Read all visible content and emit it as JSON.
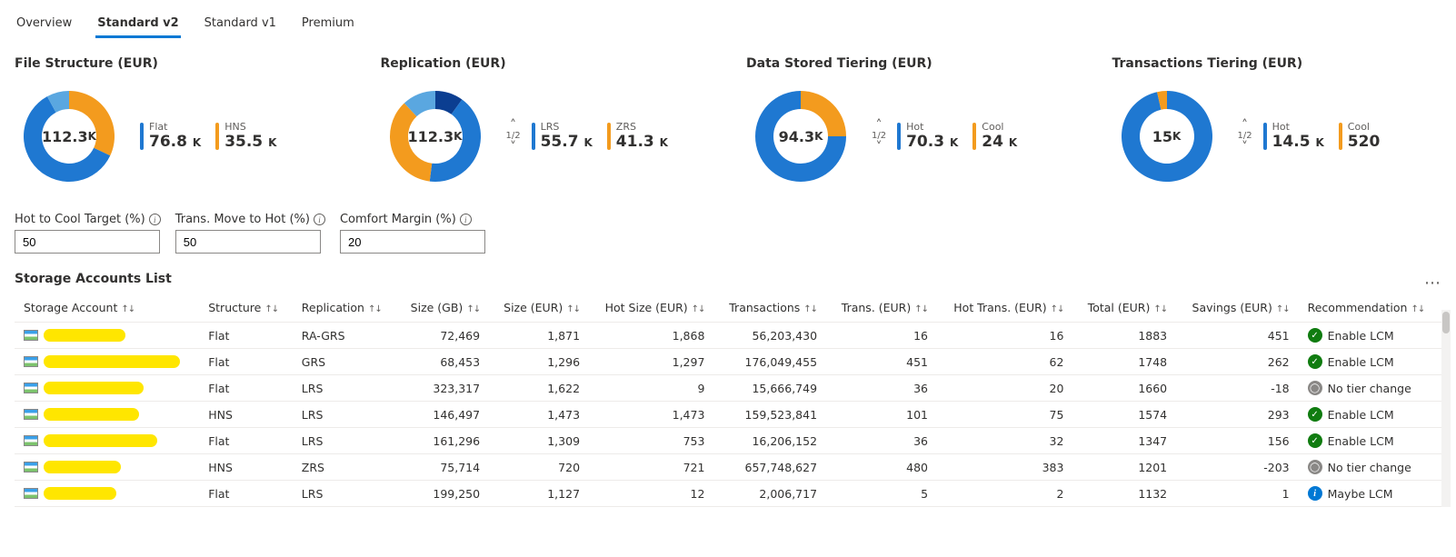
{
  "tabs": [
    "Overview",
    "Standard v2",
    "Standard v1",
    "Premium"
  ],
  "active_tab": 1,
  "charts": [
    {
      "title": "File Structure (EUR)",
      "center": "112.3",
      "center_unit": "K",
      "pager": null,
      "legend": [
        {
          "label": "Flat",
          "value": "76.8",
          "unit": "K",
          "color": "#1f78d1"
        },
        {
          "label": "HNS",
          "value": "35.5",
          "unit": "K",
          "color": "#f39b1e"
        }
      ],
      "slices": [
        {
          "color": "#f39b1e",
          "frac": 0.32
        },
        {
          "color": "#1f78d1",
          "frac": 0.6
        },
        {
          "color": "#5aa7e0",
          "frac": 0.08
        }
      ]
    },
    {
      "title": "Replication (EUR)",
      "center": "112.3",
      "center_unit": "K",
      "pager": "1/2",
      "legend": [
        {
          "label": "LRS",
          "value": "55.7",
          "unit": "K",
          "color": "#1f78d1"
        },
        {
          "label": "ZRS",
          "value": "41.3",
          "unit": "K",
          "color": "#f39b1e"
        }
      ],
      "slices": [
        {
          "color": "#0b3e91",
          "frac": 0.1
        },
        {
          "color": "#1f78d1",
          "frac": 0.42
        },
        {
          "color": "#f39b1e",
          "frac": 0.36
        },
        {
          "color": "#5aa7e0",
          "frac": 0.12
        }
      ]
    },
    {
      "title": "Data Stored Tiering (EUR)",
      "center": "94.3",
      "center_unit": "K",
      "pager": "1/2",
      "legend": [
        {
          "label": "Hot",
          "value": "70.3",
          "unit": "K",
          "color": "#1f78d1"
        },
        {
          "label": "Cool",
          "value": "24",
          "unit": "K",
          "color": "#f39b1e"
        }
      ],
      "slices": [
        {
          "color": "#f39b1e",
          "frac": 0.25
        },
        {
          "color": "#1f78d1",
          "frac": 0.75
        }
      ]
    },
    {
      "title": "Transactions Tiering (EUR)",
      "center": "15",
      "center_unit": "K",
      "pager": "1/2",
      "legend": [
        {
          "label": "Hot",
          "value": "14.5",
          "unit": "K",
          "color": "#1f78d1"
        },
        {
          "label": "Cool",
          "value": "520",
          "unit": "",
          "color": "#f39b1e"
        }
      ],
      "slices": [
        {
          "color": "#1f78d1",
          "frac": 0.965
        },
        {
          "color": "#f39b1e",
          "frac": 0.035
        }
      ]
    }
  ],
  "inputs": [
    {
      "label": "Hot to Cool Target (%)",
      "value": "50"
    },
    {
      "label": "Trans. Move to Hot (%)",
      "value": "50"
    },
    {
      "label": "Comfort Margin (%)",
      "value": "20"
    }
  ],
  "list_title": "Storage Accounts List",
  "columns": [
    {
      "label": "Storage Account",
      "num": false
    },
    {
      "label": "Structure",
      "num": false
    },
    {
      "label": "Replication",
      "num": false
    },
    {
      "label": "Size (GB)",
      "num": true
    },
    {
      "label": "Size (EUR)",
      "num": true
    },
    {
      "label": "Hot Size (EUR)",
      "num": true
    },
    {
      "label": "Transactions",
      "num": true
    },
    {
      "label": "Trans. (EUR)",
      "num": true
    },
    {
      "label": "Hot Trans. (EUR)",
      "num": true
    },
    {
      "label": "Total (EUR)",
      "num": true
    },
    {
      "label": "Savings (EUR)",
      "num": true
    },
    {
      "label": "Recommendation",
      "num": false
    }
  ],
  "rows": [
    {
      "rw": 90,
      "structure": "Flat",
      "replication": "RA-GRS",
      "size_gb": "72,469",
      "size_eur": "1,871",
      "hot_size": "1,868",
      "trans": "56,203,430",
      "trans_eur": "16",
      "hot_trans": "16",
      "total": "1883",
      "savings": "451",
      "rec": "Enable LCM",
      "rec_kind": "ok"
    },
    {
      "rw": 150,
      "structure": "Flat",
      "replication": "GRS",
      "size_gb": "68,453",
      "size_eur": "1,296",
      "hot_size": "1,297",
      "trans": "176,049,455",
      "trans_eur": "451",
      "hot_trans": "62",
      "total": "1748",
      "savings": "262",
      "rec": "Enable LCM",
      "rec_kind": "ok"
    },
    {
      "rw": 110,
      "structure": "Flat",
      "replication": "LRS",
      "size_gb": "323,317",
      "size_eur": "1,622",
      "hot_size": "9",
      "trans": "15,666,749",
      "trans_eur": "36",
      "hot_trans": "20",
      "total": "1660",
      "savings": "-18",
      "rec": "No tier change",
      "rec_kind": "none"
    },
    {
      "rw": 105,
      "structure": "HNS",
      "replication": "LRS",
      "size_gb": "146,497",
      "size_eur": "1,473",
      "hot_size": "1,473",
      "trans": "159,523,841",
      "trans_eur": "101",
      "hot_trans": "75",
      "total": "1574",
      "savings": "293",
      "rec": "Enable LCM",
      "rec_kind": "ok"
    },
    {
      "rw": 125,
      "structure": "Flat",
      "replication": "LRS",
      "size_gb": "161,296",
      "size_eur": "1,309",
      "hot_size": "753",
      "trans": "16,206,152",
      "trans_eur": "36",
      "hot_trans": "32",
      "total": "1347",
      "savings": "156",
      "rec": "Enable LCM",
      "rec_kind": "ok"
    },
    {
      "rw": 85,
      "structure": "HNS",
      "replication": "ZRS",
      "size_gb": "75,714",
      "size_eur": "720",
      "hot_size": "721",
      "trans": "657,748,627",
      "trans_eur": "480",
      "hot_trans": "383",
      "total": "1201",
      "savings": "-203",
      "rec": "No tier change",
      "rec_kind": "none"
    },
    {
      "rw": 80,
      "structure": "Flat",
      "replication": "LRS",
      "size_gb": "199,250",
      "size_eur": "1,127",
      "hot_size": "12",
      "trans": "2,006,717",
      "trans_eur": "5",
      "hot_trans": "2",
      "total": "1132",
      "savings": "1",
      "rec": "Maybe LCM",
      "rec_kind": "info"
    }
  ],
  "chart_data": [
    {
      "type": "pie",
      "title": "File Structure (EUR)",
      "total": 112300,
      "series": [
        {
          "name": "Flat",
          "value": 76800
        },
        {
          "name": "HNS",
          "value": 35500
        }
      ]
    },
    {
      "type": "pie",
      "title": "Replication (EUR)",
      "total": 112300,
      "series": [
        {
          "name": "LRS",
          "value": 55700
        },
        {
          "name": "ZRS",
          "value": 41300
        }
      ]
    },
    {
      "type": "pie",
      "title": "Data Stored Tiering (EUR)",
      "total": 94300,
      "series": [
        {
          "name": "Hot",
          "value": 70300
        },
        {
          "name": "Cool",
          "value": 24000
        }
      ]
    },
    {
      "type": "pie",
      "title": "Transactions Tiering (EUR)",
      "total": 15000,
      "series": [
        {
          "name": "Hot",
          "value": 14500
        },
        {
          "name": "Cool",
          "value": 520
        }
      ]
    }
  ]
}
